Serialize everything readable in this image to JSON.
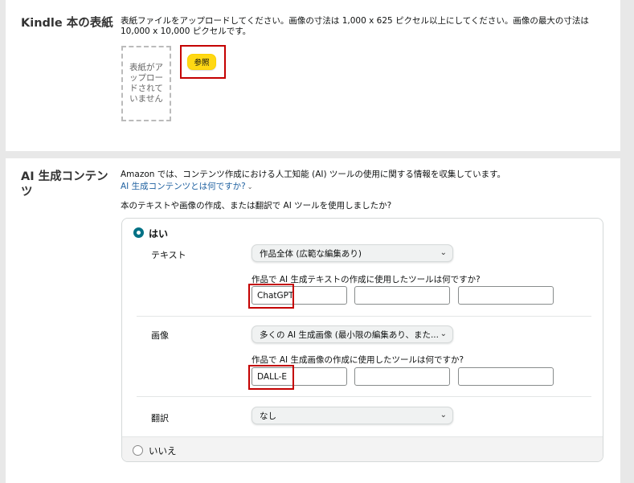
{
  "cover": {
    "title": "Kindle 本の表紙",
    "description": "表紙ファイルをアップロードしてください。画像の寸法は 1,000 x 625 ピクセル以上にしてください。画像の最大の寸法は 10,000 x 10,000 ピクセルです。",
    "placeholder": "表紙がアップロードされていません",
    "browse_label": "参照"
  },
  "ai": {
    "title": "AI 生成コンテンツ",
    "description": "Amazon では、コンテンツ作成における人工知能 (AI) ツールの使用に関する情報を収集しています。",
    "link": "AI 生成コンテンツとは何ですか?",
    "question": "本のテキストや画像の作成、または翻訳で AI ツールを使用しましたか?",
    "yes_label": "はい",
    "no_label": "いいえ",
    "selected": "はい",
    "text": {
      "label": "テキスト",
      "select_value": "作品全体 (広範な編集あり)",
      "tool_question": "作品で AI 生成テキストの作成に使用したツールは何ですか?",
      "tools": [
        "ChatGPT",
        "",
        ""
      ]
    },
    "image": {
      "label": "画像",
      "select_value": "多くの AI 生成画像 (最小限の編集あり、また...",
      "tool_question": "作品で AI 生成画像の作成に使用したツールは何ですか?",
      "tools": [
        "DALL-E",
        "",
        ""
      ]
    },
    "translation": {
      "label": "翻訳",
      "select_value": "なし"
    }
  },
  "colors": {
    "accent": "#007185",
    "button": "#ffd814",
    "highlight": "#c40000",
    "link": "#2162a1"
  }
}
